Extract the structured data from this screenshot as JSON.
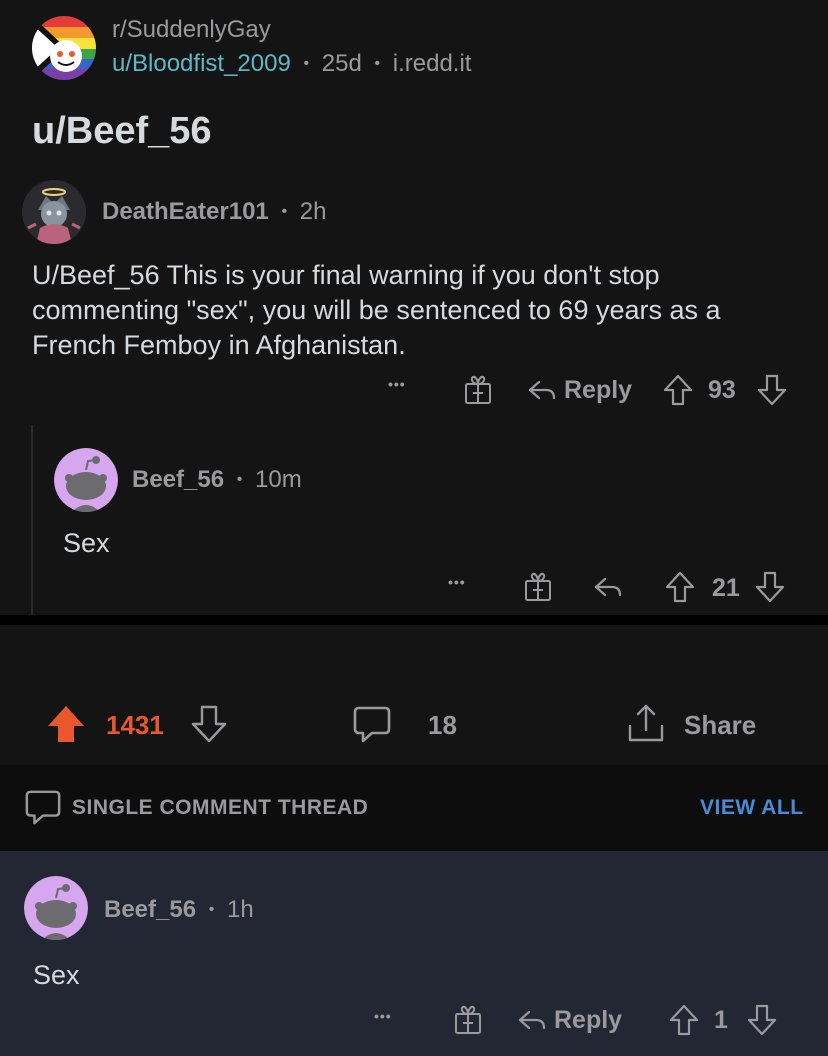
{
  "post": {
    "subreddit": "r/SuddenlyGay",
    "author": "u/Bloodfist_2009",
    "sep": "•",
    "age": "25d",
    "domain": "i.redd.it",
    "title": "u/Beef_56"
  },
  "comment1": {
    "author": "DeathEater101",
    "sep": "•",
    "age": "2h",
    "body": "U/Beef_56 This is your final warning if you don't stop commenting \"sex\", you will be sentenced to 69 years as a French Femboy in Afghanistan.",
    "more": "•••",
    "reply_label": "Reply",
    "score": "93"
  },
  "comment2": {
    "author": "Beef_56",
    "sep": "•",
    "age": "10m",
    "body": "Sex",
    "more": "•••",
    "score": "21"
  },
  "post_actions": {
    "upvotes": "1431",
    "comments": "18",
    "share_label": "Share",
    "upvote_color": "#e8582c"
  },
  "thread_bar": {
    "label": "SINGLE COMMENT THREAD",
    "view_all": "VIEW ALL"
  },
  "comment3": {
    "author": "Beef_56",
    "sep": "•",
    "age": "1h",
    "body": "Sex",
    "more": "•••",
    "reply_label": "Reply",
    "score": "1"
  },
  "colors": {
    "background": "#141415",
    "panel": "#232733",
    "link": "#5fb7c8",
    "accent_blue": "#4c8ad8",
    "avatar_purple": "#d6a6ee"
  },
  "icons": {
    "subreddit": "suddenlygay-snoo-icon",
    "more": "more-options-icon",
    "award": "award-gift-icon",
    "reply": "reply-arrow-icon",
    "upvote": "upvote-arrow-icon",
    "downvote": "downvote-arrow-icon",
    "comment": "comment-bubble-icon",
    "share": "share-icon"
  }
}
